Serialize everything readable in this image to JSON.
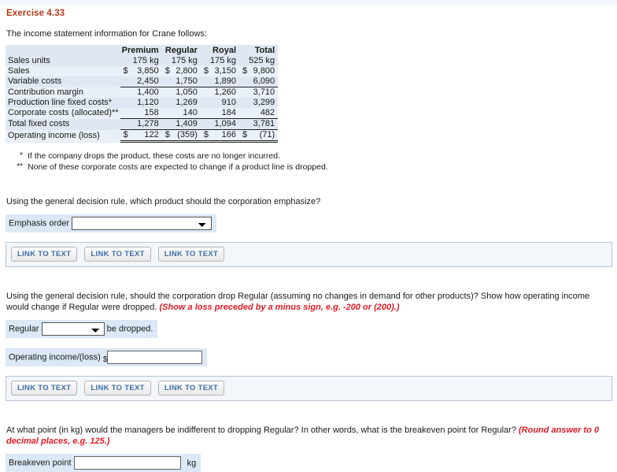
{
  "exercise": {
    "title": "Exercise 4.33",
    "intro": "The income statement information for Crane follows:"
  },
  "table": {
    "columns": [
      "",
      "Premium",
      "Regular",
      "Royal",
      "Total"
    ],
    "rows": [
      {
        "label": "Sales units",
        "currency": [
          "",
          "",
          "",
          ""
        ],
        "values": [
          "175 kg",
          "175 kg",
          "175 kg",
          "525 kg"
        ],
        "rule": "none"
      },
      {
        "label": "Sales",
        "currency": [
          "$",
          "$",
          "$",
          "$"
        ],
        "values": [
          "3,850",
          "2,800",
          "3,150",
          "9,800"
        ],
        "rule": "none"
      },
      {
        "label": "Variable costs",
        "currency": [
          "",
          "",
          "",
          ""
        ],
        "values": [
          "2,450",
          "1,750",
          "1,890",
          "6,090"
        ],
        "rule": "none"
      },
      {
        "label": "Contribution margin",
        "currency": [
          "",
          "",
          "",
          ""
        ],
        "values": [
          "1,400",
          "1,050",
          "1,260",
          "3,710"
        ],
        "rule": "top"
      },
      {
        "label": "Production line fixed costs*",
        "currency": [
          "",
          "",
          "",
          ""
        ],
        "values": [
          "1,120",
          "1,269",
          "910",
          "3,299"
        ],
        "rule": "none"
      },
      {
        "label": "Corporate costs (allocated)**",
        "currency": [
          "",
          "",
          "",
          ""
        ],
        "values": [
          "158",
          "140",
          "184",
          "482"
        ],
        "rule": "none"
      },
      {
        "label": "Total fixed costs",
        "currency": [
          "",
          "",
          "",
          ""
        ],
        "values": [
          "1,278",
          "1,409",
          "1,094",
          "3,781"
        ],
        "rule": "top"
      },
      {
        "label": "Operating income (loss)",
        "currency": [
          "$",
          "$",
          "$",
          "$"
        ],
        "values": [
          "122",
          "(359)",
          "166",
          "(71)"
        ],
        "rule": "double"
      }
    ]
  },
  "notes": [
    {
      "marker": "*",
      "text": "If the company drops the product, these costs are no longer incurred."
    },
    {
      "marker": "**",
      "text": "None of these corporate costs are expected to change if a product line is dropped."
    }
  ],
  "section1": {
    "question": "Using the general decision rule, which product should the corporation emphasize?",
    "field_label": "Emphasis order",
    "dropdown_value": "",
    "dropdown_options": [
      ""
    ]
  },
  "section2": {
    "question_part1": "Using the general decision rule, should the corporation drop Regular (assuming no changes in demand for other products)? Show how operating income would change if Regular were dropped.",
    "question_hint": "(Show a loss preceded by a minus sign, e.g. -200 or (200).)",
    "row1_prefix": "Regular",
    "row1_dropdown_value": "",
    "row1_dropdown_options": [
      ""
    ],
    "row1_suffix": "be dropped.",
    "row2_label": "Operating income/(loss)",
    "row2_currency": "$",
    "row2_value": "",
    "row2_placeholder": ""
  },
  "section3": {
    "question_part1": "At what point (in kg) would the managers be indifferent to dropping Regular? In other words, what is the breakeven point for Regular?",
    "question_hint": "(Round answer to 0 decimal places, e.g. 125.)",
    "field_label": "Breakeven point",
    "value": "",
    "placeholder": "",
    "unit": "kg"
  },
  "link_buttons": {
    "label": "LINK TO TEXT",
    "count": 3
  },
  "colors": {
    "title": "#b03a1a",
    "hint": "#e01b24",
    "table_bg": "#dfe8f2",
    "field_bg": "#dce8f6",
    "button_text": "#3f6ea8"
  }
}
